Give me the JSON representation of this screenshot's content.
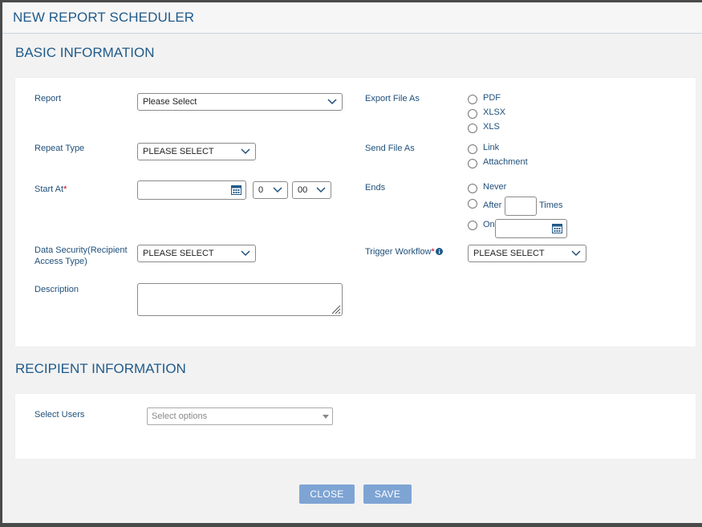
{
  "modal": {
    "title": "NEW REPORT SCHEDULER"
  },
  "basic": {
    "section_title": "BASIC INFORMATION",
    "report_label": "Report",
    "report_value": "Please Select",
    "repeat_label": "Repeat Type",
    "repeat_value": "PLEASE SELECT",
    "start_label": "Start At",
    "start_required": "*",
    "start_date_value": "",
    "start_hour_value": "0",
    "start_minute_value": "00",
    "security_label": "Data Security(Recipient Access Type)",
    "security_value": "PLEASE SELECT",
    "description_label": "Description",
    "description_value": "",
    "export_label": "Export File As",
    "export_options": [
      "PDF",
      "XLSX",
      "XLS"
    ],
    "send_label": "Send File As",
    "send_options": [
      "Link",
      "Attachment"
    ],
    "ends_label": "Ends",
    "ends_never": "Never",
    "ends_after": "After",
    "ends_times": "Times",
    "ends_on": "On",
    "trigger_label": "Trigger Workflow",
    "trigger_required": "*",
    "trigger_value": "PLEASE SELECT"
  },
  "recipient": {
    "section_title": "RECIPIENT INFORMATION",
    "users_label": "Select Users",
    "users_placeholder": "Select options"
  },
  "footer": {
    "close_label": "CLOSE",
    "save_label": "SAVE"
  },
  "colors": {
    "accent": "#1f5a8a",
    "button": "#7ea4d4",
    "required": "#d0021b"
  }
}
